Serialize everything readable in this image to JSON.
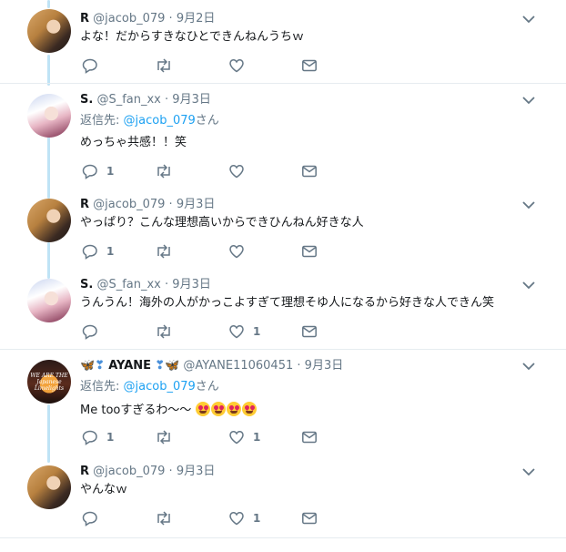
{
  "colors": {
    "link": "#1da1f2",
    "meta": "#657786",
    "text": "#14171a",
    "thread": "#bfe3f5",
    "separator": "#e6ecf0"
  },
  "tweets": [
    {
      "name": "R",
      "handle": "@jacob_079",
      "date": "9月2日",
      "reply_prefix": "",
      "reply_link": "",
      "reply_suffix": "",
      "text": "よな！だからすきなひとできんねんうちｗ",
      "reply_count": "",
      "retweet_count": "",
      "like_count": "",
      "avatar": "jacob"
    },
    {
      "name": "S.",
      "handle": "@S_fan_xx",
      "date": "9月3日",
      "reply_prefix": "返信先: ",
      "reply_link": "@jacob_079",
      "reply_suffix": "さん",
      "text": "めっちゃ共感！！笑",
      "reply_count": "1",
      "retweet_count": "",
      "like_count": "",
      "avatar": "sfan"
    },
    {
      "name": "R",
      "handle": "@jacob_079",
      "date": "9月3日",
      "reply_prefix": "",
      "reply_link": "",
      "reply_suffix": "",
      "text": "やっぱり？こんな理想高いからできひんねん好きな人",
      "reply_count": "1",
      "retweet_count": "",
      "like_count": "",
      "avatar": "jacob"
    },
    {
      "name": "S.",
      "handle": "@S_fan_xx",
      "date": "9月3日",
      "reply_prefix": "",
      "reply_link": "",
      "reply_suffix": "",
      "text": "うんうん！海外の人がかっこよすぎて理想そゆ人になるから好きな人できん笑",
      "reply_count": "",
      "retweet_count": "",
      "like_count": "1",
      "avatar": "sfan"
    },
    {
      "name": "AYANE",
      "name_decor_left": "🦋❣",
      "name_decor_right": "❣🦋",
      "handle": "@AYANE11060451",
      "date": "9月3日",
      "reply_prefix": "返信先: ",
      "reply_link": "@jacob_079",
      "reply_suffix": "さん",
      "text": "Me tooすぎるわ〜〜",
      "emoji_count": 4,
      "emoji": "heart-eyes-emoji",
      "reply_count": "1",
      "retweet_count": "",
      "like_count": "1",
      "avatar": "ayane",
      "avatar_text": [
        "WE ARE THE",
        "Japanese",
        "Limelights"
      ]
    },
    {
      "name": "R",
      "handle": "@jacob_079",
      "date": "9月3日",
      "reply_prefix": "",
      "reply_link": "",
      "reply_suffix": "",
      "text": "やんなｗ",
      "reply_count": "",
      "retweet_count": "",
      "like_count": "1",
      "avatar": "jacob"
    }
  ],
  "separator": "·"
}
